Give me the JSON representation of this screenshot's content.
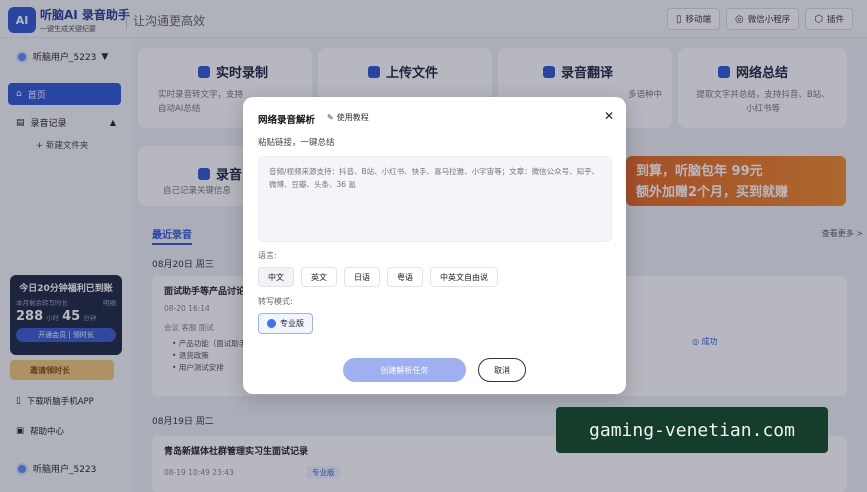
{
  "header": {
    "logo_mark": "AI",
    "logo_title": "听脑AI 录音助手",
    "logo_subtitle": "一键生成关键纪要",
    "slogan": "让沟通更高效",
    "actions": [
      {
        "label": "移动端",
        "icon": "mobile-icon"
      },
      {
        "label": "微信小程序",
        "icon": "miniprogram-icon"
      },
      {
        "label": "插件",
        "icon": "plugin-icon"
      }
    ]
  },
  "sidebar": {
    "user_name": "听脑用户_5223",
    "nav_home": "首页",
    "nav_recordings": "录音记录",
    "nav_new_folder": "+ 新建文件夹",
    "promo": {
      "title": "今日20分钟福利已到账",
      "sub_left": "本月剩余转写时长",
      "sub_right": "明细",
      "hours": "288",
      "hours_unit": "小时",
      "minutes": "45",
      "minutes_unit": "分钟",
      "button": "开通会员 | 领时长"
    },
    "invite": "邀请领时长",
    "download_app": "下载听脑手机APP",
    "help": "帮助中心",
    "bottom_user": "听脑用户_5223"
  },
  "main": {
    "cards": [
      {
        "title": "实时录制",
        "desc": "实时录音转文字，支持\n自动AI总结"
      },
      {
        "title": "上传文件",
        "desc": ""
      },
      {
        "title": "录音翻译",
        "desc": "多语种中"
      },
      {
        "title": "网络总结",
        "desc": "提取文字并总结，支持抖音、B站、\n小红书等"
      }
    ],
    "card5_title": "录音",
    "card5_desc": "自己记录关键信息",
    "banner_line1": "到算，听脑包年 99元",
    "banner_line2": "额外加赠2个月，买到就赚",
    "tab_recent": "最近录音",
    "view_more": "查看更多 >",
    "date1": "08月20日 周三",
    "item1_title": "面试助手等产品讨论",
    "item1_meta": "08-20 16:14",
    "item1_tags": "会议  客服  面试",
    "item1_bullets": [
      "• 产品功能（面试助手）",
      "• 退货政策",
      "• 用户测试安排"
    ],
    "item1_status": "◎ 成功",
    "date2": "08月19日 周二",
    "item2_title": "青岛新媒体社群管理实习生面试记录",
    "item2_meta": "08-19 10:49    23:43",
    "item2_tag": "专业版"
  },
  "modal": {
    "title": "网络录音解析",
    "tutorial": "使用教程",
    "paste_label": "粘贴链接，一键总结",
    "placeholder": "音频/视频来源支持：抖音、B站、小红书、快手、喜马拉雅、小宇宙等；文章：微信公众号、知乎、微博、豆瓣、头条、36 氪",
    "lang_label": "语言:",
    "languages": [
      "中文",
      "英文",
      "日语",
      "粤语",
      "中英文自由说"
    ],
    "mode_label": "转写模式:",
    "mode": "专业版",
    "create_button": "创建解析任务",
    "cancel_button": "取消"
  },
  "watermark": "gaming-venetian.com"
}
